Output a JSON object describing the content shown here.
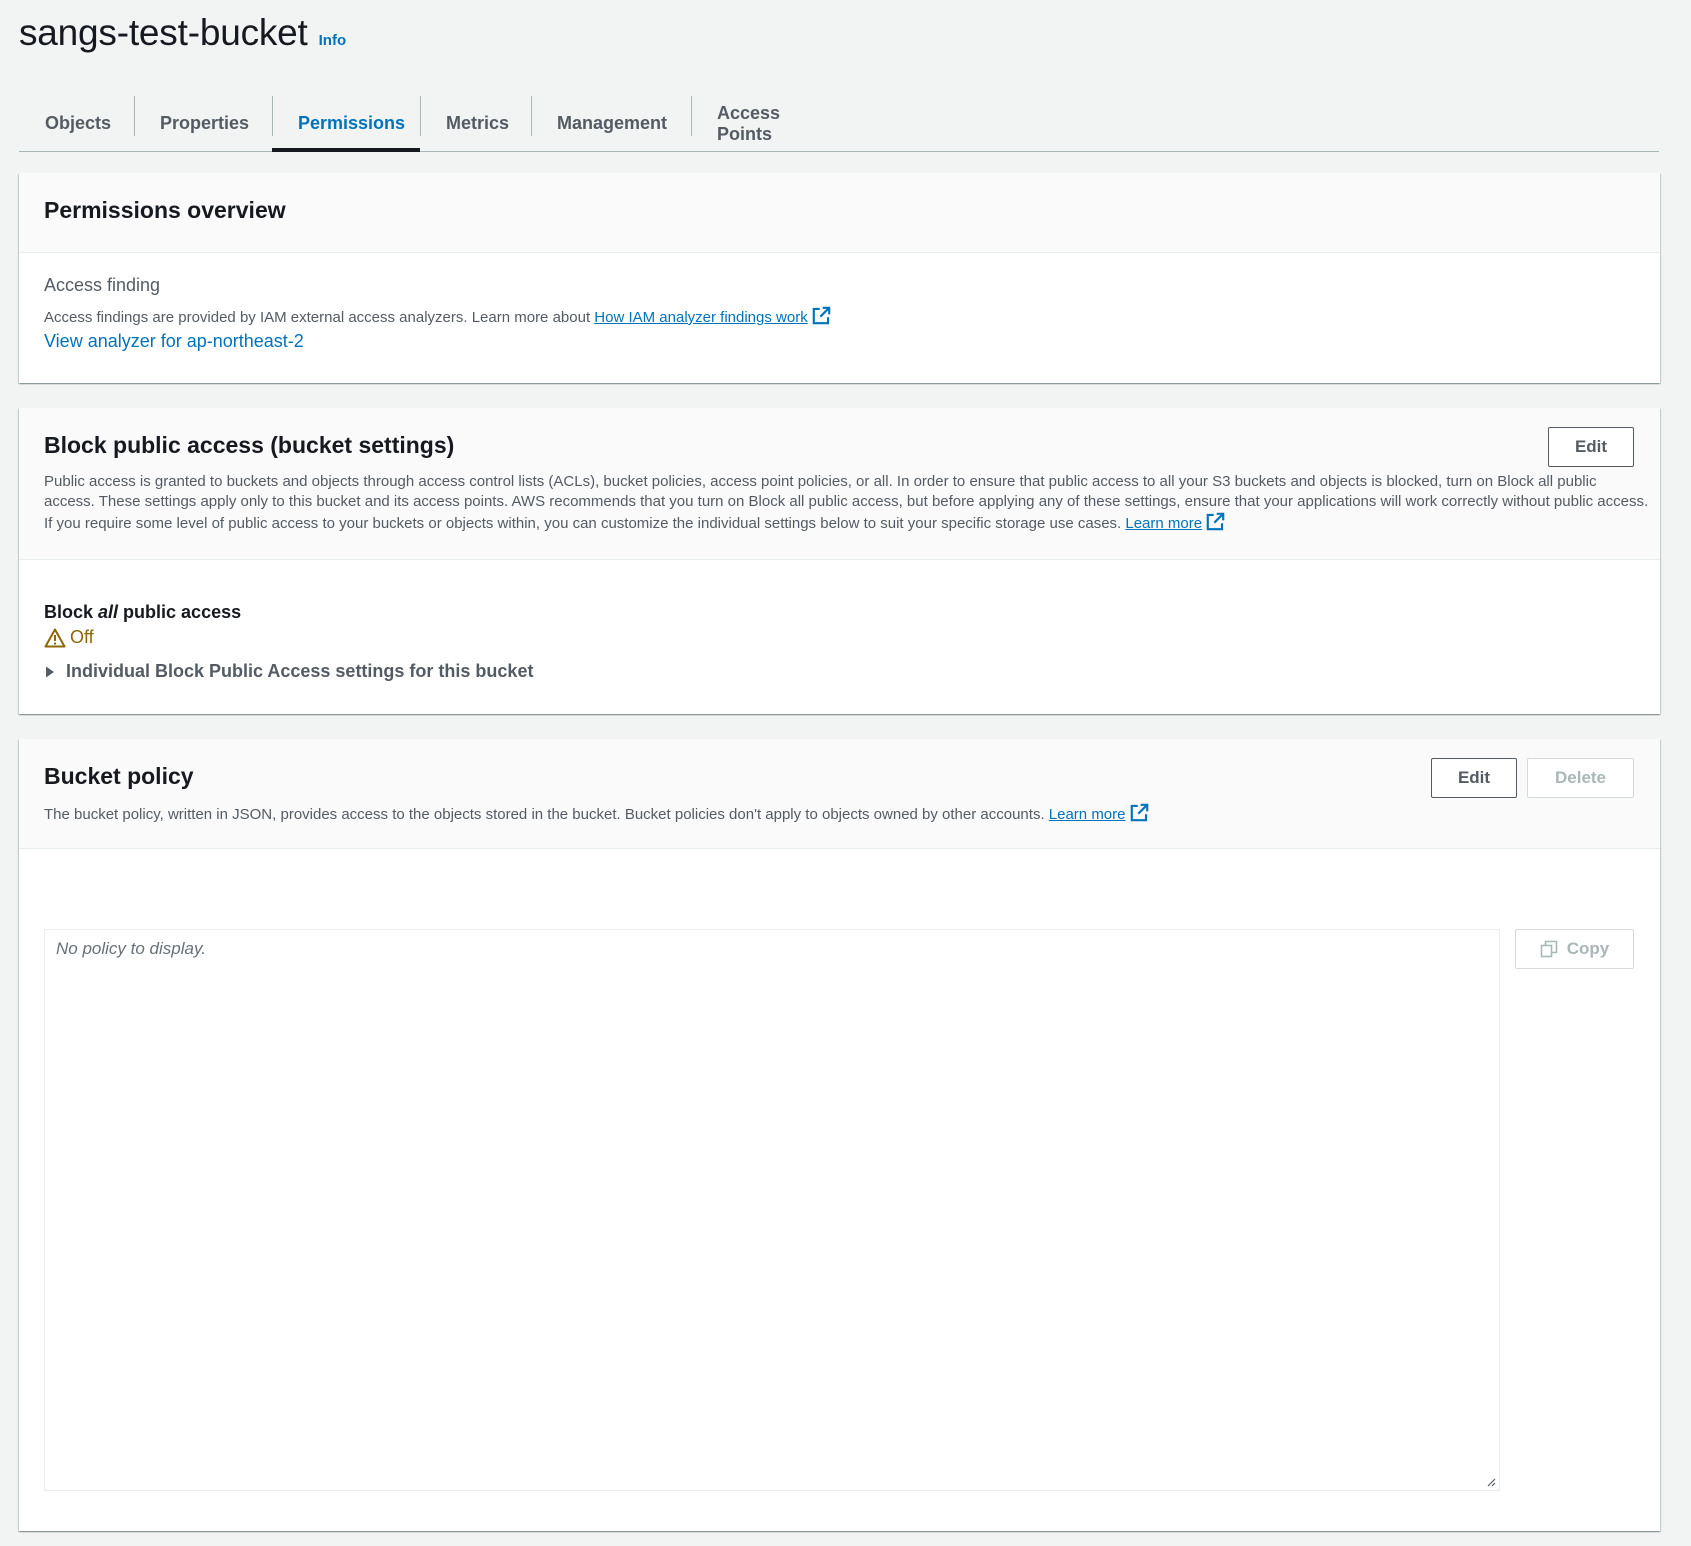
{
  "header": {
    "title": "sangs-test-bucket",
    "info_label": "Info"
  },
  "tabs": [
    {
      "label": "Objects",
      "active": false
    },
    {
      "label": "Properties",
      "active": false
    },
    {
      "label": "Permissions",
      "active": true
    },
    {
      "label": "Metrics",
      "active": false
    },
    {
      "label": "Management",
      "active": false
    },
    {
      "label": "Access Points",
      "active": false
    }
  ],
  "permissions_overview": {
    "title": "Permissions overview",
    "access_finding_label": "Access finding",
    "description": "Access findings are provided by IAM external access analyzers. Learn more about ",
    "link_label": "How IAM analyzer findings work",
    "analyzer_link": "View analyzer for ap-northeast-2"
  },
  "block_public_access": {
    "title": "Block public access (bucket settings)",
    "edit_label": "Edit",
    "description": "Public access is granted to buckets and objects through access control lists (ACLs), bucket policies, access point policies, or all. In order to ensure that public access to all your S3 buckets and objects is blocked, turn on Block all public access. These settings apply only to this bucket and its access points. AWS recommends that you turn on Block all public access, but before applying any of these settings, ensure that your applications will work correctly without public access. If you require some level of public access to your buckets or objects within, you can customize the individual settings below to suit your specific storage use cases. ",
    "learn_more": "Learn more",
    "block_all_prefix": "Block ",
    "block_all_em": "all",
    "block_all_suffix": " public access",
    "status": "Off",
    "expander_label": "Individual Block Public Access settings for this bucket"
  },
  "bucket_policy": {
    "title": "Bucket policy",
    "edit_label": "Edit",
    "delete_label": "Delete",
    "description": "The bucket policy, written in JSON, provides access to the objects stored in the bucket. Bucket policies don't apply to objects owned by other accounts. ",
    "learn_more": "Learn more",
    "placeholder": "No policy to display.",
    "copy_label": "Copy"
  },
  "colors": {
    "link": "#0073bb",
    "warning": "#8d6605",
    "text": "#16191f",
    "background": "#f2f3f3"
  }
}
